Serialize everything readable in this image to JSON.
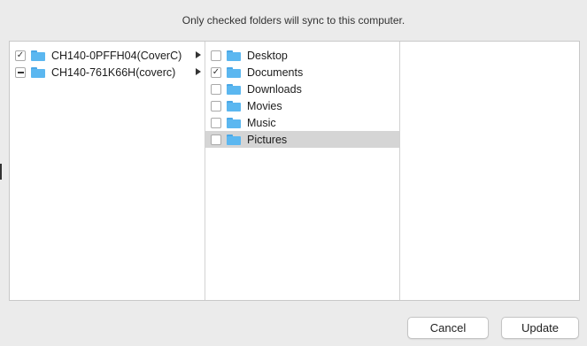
{
  "header": {
    "message": "Only checked folders will sync to this computer."
  },
  "devices": [
    {
      "label": "CH140-0PFFH04(CoverC)",
      "check": "✓",
      "state": "checked"
    },
    {
      "label": "CH140-761K66H(coverc)",
      "check": "",
      "state": "mixed"
    }
  ],
  "folders": [
    {
      "label": "Desktop",
      "check": "",
      "selected": false
    },
    {
      "label": "Documents",
      "check": "✓",
      "selected": false
    },
    {
      "label": "Downloads",
      "check": "",
      "selected": false
    },
    {
      "label": "Movies",
      "check": "",
      "selected": false
    },
    {
      "label": "Music",
      "check": "",
      "selected": false
    },
    {
      "label": "Pictures",
      "check": "",
      "selected": true
    }
  ],
  "buttons": {
    "cancel": "Cancel",
    "update": "Update"
  },
  "icons": {
    "folder": "folder-icon",
    "disclosure": "disclosure-arrow-icon"
  },
  "colors": {
    "folder": "#5bb7f0",
    "selection": "#d5d5d5"
  }
}
